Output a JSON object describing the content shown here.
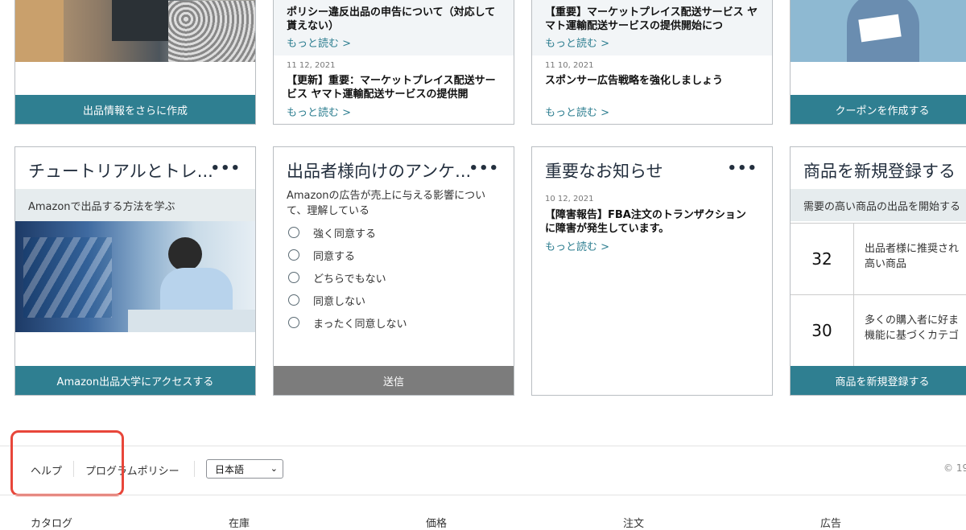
{
  "row1": {
    "card1": {
      "button": "出品情報をさらに作成"
    },
    "card2": {
      "top_text": "ポリシー違反出品の申告について（対応して貰えない）",
      "top_more": "もっと読む >",
      "item_date": "11 12, 2021",
      "item_text": "【更新】重要：マーケットプレイス配送サービス ヤマト運輸配送サービスの提供開",
      "item_more": "もっと読む >"
    },
    "card3": {
      "top_text": "【重要】マーケットプレイス配送サービス ヤマト運輸配送サービスの提供開始につ",
      "top_more": "もっと読む >",
      "item_date": "11 10, 2021",
      "item_text": "スポンサー広告戦略を強化しましょう",
      "item_more": "もっと読む >"
    },
    "card4": {
      "button": "クーポンを作成する"
    }
  },
  "row2": {
    "tutorial": {
      "title": "チュートリアルとトレ...",
      "dots": "•••",
      "subhead": "Amazonで出品する方法を学ぶ",
      "button": "Amazon出品大学にアクセスする"
    },
    "survey": {
      "title": "出品者様向けのアンケ...",
      "dots": "•••",
      "question": "Amazonの広告が売上に与える影響について、理解している",
      "options": [
        "強く同意する",
        "同意する",
        "どちらでもない",
        "同意しない",
        "まったく同意しない"
      ],
      "button": "送信"
    },
    "notice": {
      "title": "重要なお知らせ",
      "dots": "•••",
      "item_date": "10 12, 2021",
      "item_text": "【障害報告】FBA注文のトランザクションに障害が発生しています。",
      "item_more": "もっと読む >"
    },
    "new_product": {
      "title": "商品を新規登録する",
      "subhead": "需要の高い商品の出品を開始する",
      "rows": [
        {
          "number": "32",
          "text_line1": "出品者様に推奨され",
          "text_line2": "高い商品"
        },
        {
          "number": "30",
          "text_line1": "多くの購入者に好ま",
          "text_line2": "機能に基づくカテゴ"
        }
      ],
      "button": "商品を新規登録する"
    }
  },
  "footer": {
    "help": "ヘルプ",
    "program_policy": "プログラムポリシー",
    "language": "日本語",
    "copyright": "© 19",
    "bottom_links": [
      "カタログ",
      "在庫",
      "価格",
      "注文",
      "広告"
    ]
  },
  "colors": {
    "teal": "#2f7f91",
    "highlight": "#e8463a"
  }
}
